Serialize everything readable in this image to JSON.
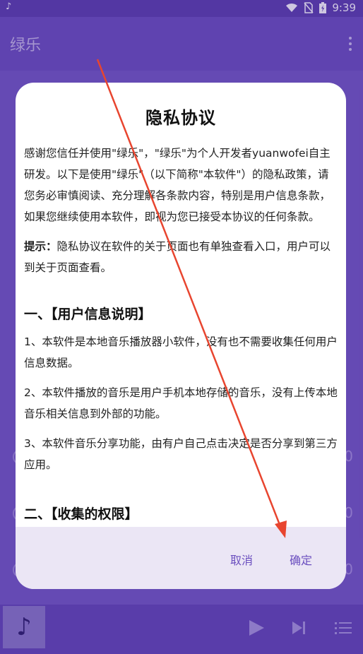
{
  "status_bar": {
    "left_icon": "music-note-icon",
    "icons": [
      "wifi-icon",
      "no-sim-icon",
      "battery-charging-icon"
    ],
    "time": "9:39"
  },
  "app_bar": {
    "title": "绿乐",
    "menu_icon": "more-vert-icon"
  },
  "background_list": {
    "rows": [
      {
        "ring_icon": "radio-icon",
        "number": "0"
      },
      {
        "ring_icon": "radio-icon",
        "number": "0"
      },
      {
        "ring_icon": "radio-icon",
        "number": "0"
      }
    ]
  },
  "dialog": {
    "title": "隐私协议",
    "intro": "感谢您信任并使用\"绿乐\"，\"绿乐\"为个人开发者yuanwofei自主研发。以下是使用\"绿乐\"（以下简称\"本软件\"）的隐私政策，请您务必审慎阅读、充分理解各条款内容，特别是用户信息条款，如果您继续使用本软件，即视为您已接受本协议的任何条款。",
    "tip_label": "提示：",
    "tip_text": "隐私协议在软件的关于页面也有单独查看入口，用户可以到关于页面查看。",
    "section1_title": "一、【用户信息说明】",
    "section1_items": [
      "1、本软件是本地音乐播放器小软件，没有也不需要收集任何用户信息数据。",
      "2、本软件播放的音乐是用户手机本地存储的音乐，没有上传本地音乐相关信息到外部的功能。",
      "3、本软件音乐分享功能，由有户自己点击决定是否分享到第三方应用。"
    ],
    "section2_title": "二、【收集的权限】",
    "cancel_label": "取消",
    "confirm_label": "确定"
  },
  "player": {
    "art_icon": "music-note-icon",
    "play_icon": "play-icon",
    "next_icon": "skip-next-icon",
    "queue_icon": "queue-list-icon"
  },
  "colors": {
    "primary": "#6b4fbf",
    "status_bar": "#5b3fae",
    "dialog_bg": "#ffffff",
    "dialog_actions_bg": "#ebe6f5",
    "arrow": "#e8452f"
  }
}
